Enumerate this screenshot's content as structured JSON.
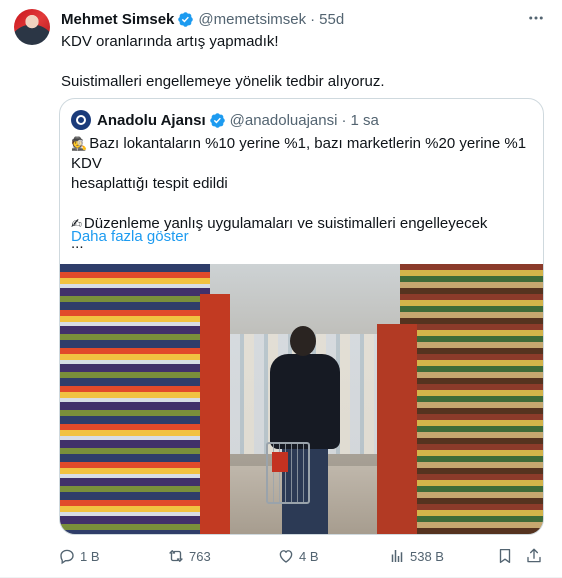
{
  "tweet": {
    "author": {
      "display_name": "Mehmet Simsek",
      "handle": "@memetsimsek",
      "separator": "·",
      "time": "55d",
      "verified_icon": "verified-badge-icon"
    },
    "text": {
      "line1": "KDV oranlarında artış yapmadık!",
      "line2": "Suistimalleri engellemeye yönelik tedbir alıyoruz."
    },
    "quote": {
      "display_name": "Anadolu Ajansı",
      "handle": "@anadoluajansi",
      "separator": "·",
      "time": "1 sa",
      "line1": "Bazı lokantaların %10 yerine %1, bazı marketlerin %20 yerine %1 KDV",
      "line2": "hesaplattığı tespit edildi",
      "line3": "Düzenleme yanlış uygulamaları ve suistimalleri engelleyecek",
      "line4": "...",
      "show_more": "Daha fazla göster",
      "emoji1": "🕵",
      "emoji2": "✍",
      "image": "supermarket-aisle-photo"
    },
    "actions": {
      "replies": "1 B",
      "retweets": "763",
      "likes": "4 B",
      "views": "538 B"
    },
    "colors": {
      "link": "#1d9bf0",
      "verified": "#1d9bf0",
      "muted": "#536471"
    }
  }
}
